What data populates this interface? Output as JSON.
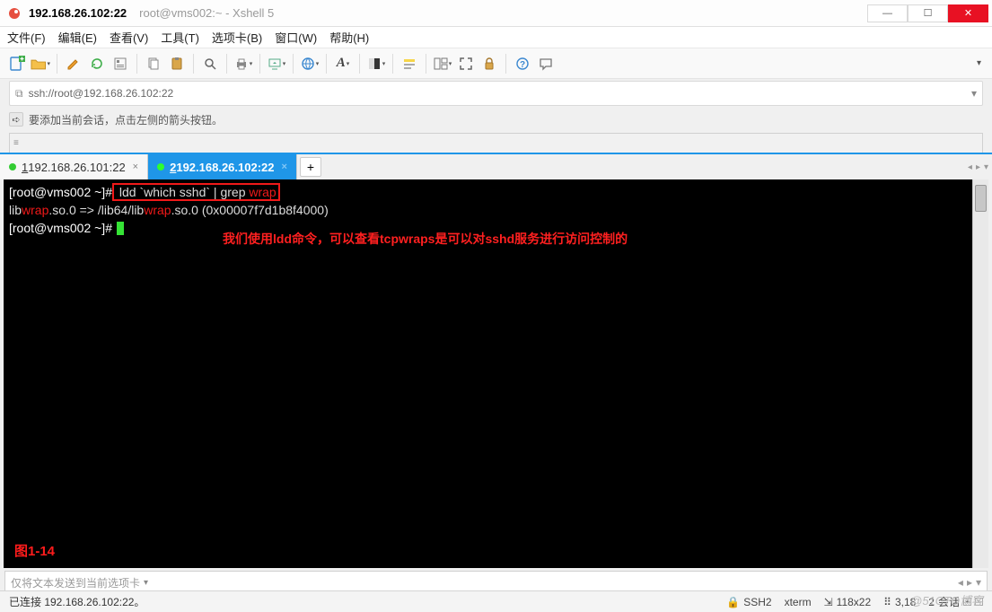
{
  "title": {
    "primary": "192.168.26.102:22",
    "secondary": "root@vms002:~ - Xshell 5"
  },
  "menu": {
    "file": "文件(F)",
    "edit": "编辑(E)",
    "view": "查看(V)",
    "tools": "工具(T)",
    "tabs": "选项卡(B)",
    "window": "窗口(W)",
    "help": "帮助(H)"
  },
  "address": {
    "url": "ssh://root@192.168.26.102:22"
  },
  "hint": {
    "text": "要添加当前会话，点击左侧的箭头按钮。",
    "icon": "➪"
  },
  "tabs": {
    "t1_num": "1",
    "t1_label": " 192.168.26.101:22",
    "t2_num": "2",
    "t2_label": " 192.168.26.102:22"
  },
  "terminal": {
    "line1_prompt": "[root@vms002 ~]#",
    "line1_cmd_a": " ldd `which sshd` | grep ",
    "line1_cmd_b": "wrap",
    "line2_a": "        lib",
    "line2_b": "wrap",
    "line2_c": ".so.0 => /lib64/lib",
    "line2_d": "wrap",
    "line2_e": ".so.0 (0x00007f7d1b8f4000)",
    "line3_prompt": "[root@vms002 ~]#",
    "annotation": "我们使用ldd命令，可以查看tcpwraps是可以对sshd服务进行访问控制的",
    "fig": "图1-14"
  },
  "sendbar": {
    "placeholder": "仅将文本发送到当前选项卡"
  },
  "status": {
    "conn": "已连接 192.168.26.102:22。",
    "proto": "SSH2",
    "term": "xterm",
    "size": "118x22",
    "cursor": "3,18",
    "sessions_n": "2",
    "sessions_l": " 会话"
  },
  "watermark": "@51CTO博客",
  "icons": {
    "lock": "🔒",
    "resize": "⤢",
    "find": "🔍",
    "globe": "🌐",
    "font": "A",
    "palette": "◧",
    "cut": "✂",
    "copy": "⧉",
    "paste": "📋",
    "fullscreen": "⛶",
    "pad": "🔒",
    "help": "?",
    "bubble": "💬",
    "new": "📄",
    "open": "📁",
    "draw": "✎",
    "db": "🗄",
    "plug": "⚗",
    "print": "🖶",
    "caret": "⏷"
  }
}
